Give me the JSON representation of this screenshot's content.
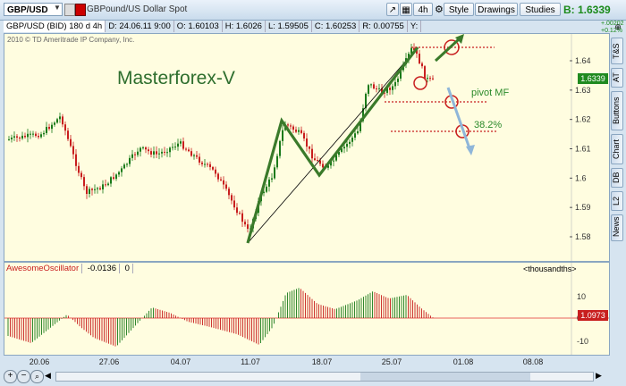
{
  "toolbar": {
    "symbol": "GBP/USD",
    "description": "GBPound/US Dollar Spot",
    "timeframe": "4h",
    "style_label": "Style",
    "drawings_label": "Drawings",
    "studies_label": "Studies",
    "bid": "B: 1.6339",
    "change1": "+.00202",
    "change2": "+0.12%"
  },
  "infobar": {
    "title": "GBP/USD (BID) 180 d 4h",
    "date": "D: 24.06.11 9:00",
    "open": "O: 1.60103",
    "high": "H: 1.6026",
    "low": "L: 1.59505",
    "close": "C: 1.60253",
    "range": "R: 0.00755",
    "y": "Y:"
  },
  "chart": {
    "copyright": "2010 © TD Ameritrade IP Company, Inc.",
    "watermark": "Masterforex-V",
    "pivot_label": "pivot MF",
    "fib_label": "38.2%",
    "price_tag": "1.6339",
    "yticks": [
      "1.64",
      "1.63",
      "1.62",
      "1.61",
      "1.6",
      "1.59",
      "1.58"
    ]
  },
  "oscillator": {
    "name": "AwesomeOscillator",
    "value": "-0.0136",
    "zero": "0",
    "units": "<thousandths>",
    "value_tag": "1.0973",
    "yticks": [
      "10",
      "0",
      "-10"
    ]
  },
  "xaxis": {
    "labels": [
      "20.06",
      "27.06",
      "04.07",
      "11.07",
      "18.07",
      "25.07",
      "01.08",
      "08.08"
    ]
  },
  "right_tabs": [
    "T&S",
    "AT",
    "Buttons",
    "Chart",
    "DB",
    "L2",
    "News"
  ],
  "colors": {
    "bg": "#fffde0",
    "up": "#1a7a1a",
    "down": "#c81e1e",
    "pattern": "#3a7a2a",
    "arrow": "#8fb6d9",
    "circle": "#c81e1e"
  }
}
